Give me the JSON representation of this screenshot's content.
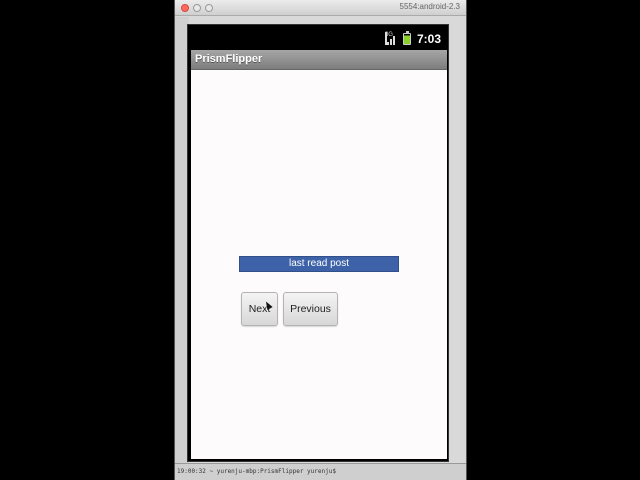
{
  "host": {
    "window_title": "5554:android-2.3",
    "terminal_text": "19:00:32 ~ yurenju-mbp:PrismFlipper yurenju$"
  },
  "status_bar": {
    "network": "3G",
    "time": "7:03"
  },
  "app": {
    "title": "PrismFlipper",
    "banner_text": "last read post",
    "next_label": "Next",
    "previous_label": "Previous"
  },
  "colors": {
    "banner_bg": "#3e62a8",
    "action_bar": "#8f8f8f",
    "battery": "#8bd12a"
  }
}
